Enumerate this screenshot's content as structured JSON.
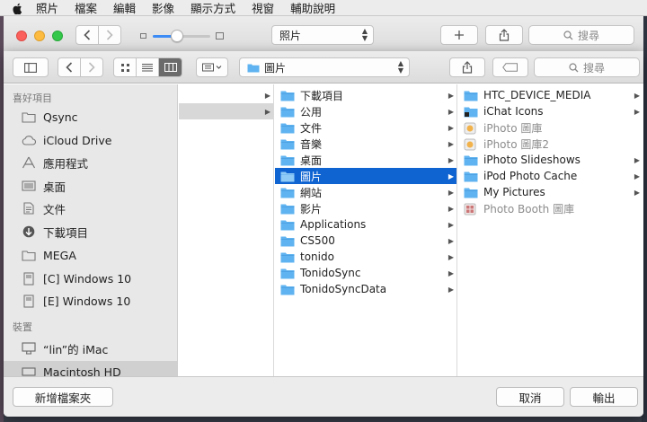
{
  "menubar": {
    "apple_icon": "apple-icon",
    "items": [
      "照片",
      "檔案",
      "編輯",
      "影像",
      "顯示方式",
      "視窗",
      "輔助說明"
    ]
  },
  "back_window": {
    "path_select": "照片",
    "search_placeholder": "搜尋"
  },
  "dialog": {
    "location": "圖片",
    "search_placeholder": "搜尋",
    "sidebar": {
      "favorites_header": "喜好項目",
      "favorites": [
        {
          "label": "Qsync",
          "icon": "folder-icon"
        },
        {
          "label": "iCloud Drive",
          "icon": "cloud-icon"
        },
        {
          "label": "應用程式",
          "icon": "applications-icon"
        },
        {
          "label": "桌面",
          "icon": "desktop-icon"
        },
        {
          "label": "文件",
          "icon": "documents-icon"
        },
        {
          "label": "下載項目",
          "icon": "downloads-icon"
        },
        {
          "label": "MEGA",
          "icon": "folder-icon"
        },
        {
          "label": "[C] Windows 10",
          "icon": "drive-icon"
        },
        {
          "label": "[E] Windows 10",
          "icon": "drive-icon"
        }
      ],
      "devices_header": "裝置",
      "devices": [
        {
          "label": "“lin”的 iMac",
          "icon": "imac-icon"
        },
        {
          "label": "Macintosh HD",
          "icon": "harddisk-icon"
        }
      ]
    },
    "column2": [
      {
        "label": "下載項目"
      },
      {
        "label": "公用"
      },
      {
        "label": "文件"
      },
      {
        "label": "音樂"
      },
      {
        "label": "桌面"
      },
      {
        "label": "圖片"
      },
      {
        "label": "網站"
      },
      {
        "label": "影片"
      },
      {
        "label": "Applications"
      },
      {
        "label": "CS500"
      },
      {
        "label": "tonido"
      },
      {
        "label": "TonidoSync"
      },
      {
        "label": "TonidoSyncData"
      }
    ],
    "column3": [
      {
        "label": "HTC_DEVICE_MEDIA"
      },
      {
        "label": "iChat Icons"
      },
      {
        "label": "iPhoto 圖庫"
      },
      {
        "label": "iPhoto 圖庫2"
      },
      {
        "label": "iPhoto Slideshows"
      },
      {
        "label": "iPod Photo Cache"
      },
      {
        "label": "My Pictures"
      },
      {
        "label": "Photo Booth 圖庫"
      }
    ],
    "buttons": {
      "new_folder": "新增檔案夾",
      "cancel": "取消",
      "export": "輸出"
    }
  },
  "colors": {
    "selection": "#0f64d2",
    "folder": "#5fb3f0",
    "sidebar_bg": "#e8e8e8"
  }
}
